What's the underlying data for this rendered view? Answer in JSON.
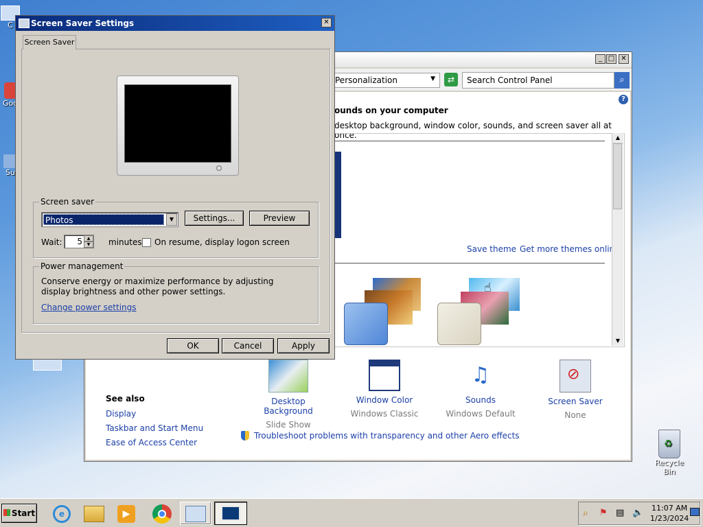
{
  "desktop": {
    "icons": [
      {
        "label": "C"
      },
      {
        "label": "Goo"
      },
      {
        "label": "Su"
      },
      {
        "label": "Recycle Bin"
      }
    ]
  },
  "control_panel": {
    "address": "Personalization",
    "search_placeholder": "Search Control Panel",
    "heading": "ounds on your computer",
    "subheading": "desktop background, window color, sounds, and screen saver all at once.",
    "save_theme": "Save theme",
    "get_more_themes": "Get more themes online",
    "see_also_title": "See also",
    "see_also": [
      "Display",
      "Taskbar and Start Menu",
      "Ease of Access Center"
    ],
    "bottom_items": [
      {
        "title": "Desktop Background",
        "sub": "Slide Show"
      },
      {
        "title": "Window Color",
        "sub": "Windows Classic"
      },
      {
        "title": "Sounds",
        "sub": "Windows Default"
      },
      {
        "title": "Screen Saver",
        "sub": "None"
      }
    ],
    "troubleshoot": "Troubleshoot problems with transparency and other Aero effects"
  },
  "dialog": {
    "title": "Screen Saver Settings",
    "tab": "Screen Saver",
    "screensaver_group": "Screen saver",
    "screensaver_value": "Photos",
    "settings_button": "Settings...",
    "preview_button": "Preview",
    "wait_label": "Wait:",
    "wait_value": "5",
    "minutes_label": "minutes",
    "resume_label": "On resume, display logon screen",
    "power_group": "Power management",
    "power_text": "Conserve energy or maximize performance by adjusting display brightness and other power settings.",
    "power_link": "Change power settings",
    "ok": "OK",
    "cancel": "Cancel",
    "apply": "Apply"
  },
  "taskbar": {
    "start": "Start",
    "time": "11:07 AM",
    "date": "1/23/2024"
  },
  "colors": {
    "accent": "#0a246a",
    "link": "#1a3fa7"
  }
}
